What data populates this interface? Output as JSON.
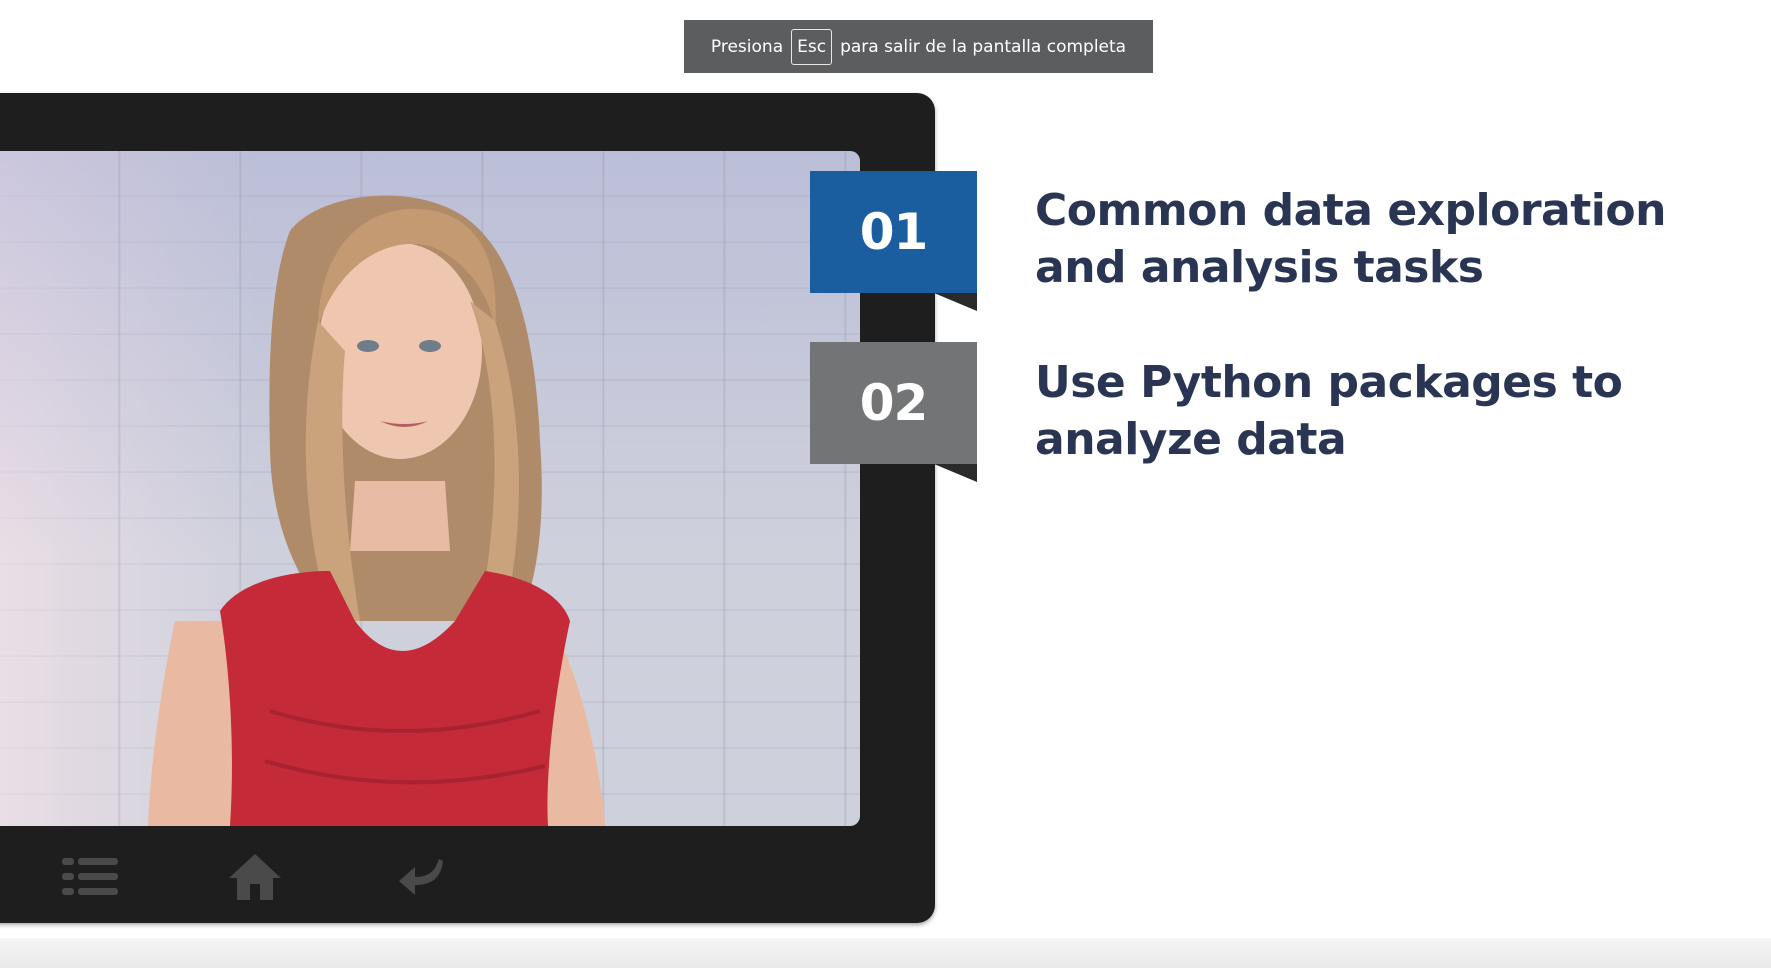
{
  "fullscreen_notice": {
    "prefix": "Presiona",
    "key": "Esc",
    "suffix": "para salir de la pantalla completa"
  },
  "agenda": [
    {
      "number": "01",
      "text": "Common data exploration and analysis tasks",
      "color": "#1a5e9f"
    },
    {
      "number": "02",
      "text": "Use Python packages to analyze data",
      "color": "#737476"
    }
  ],
  "toolbar": {
    "icons": [
      "menu-list-icon",
      "home-icon",
      "back-arrow-icon"
    ]
  },
  "colors": {
    "text": "#2a3553",
    "frame": "#1e1e1e",
    "notice_bg": "#5c5d5f"
  }
}
